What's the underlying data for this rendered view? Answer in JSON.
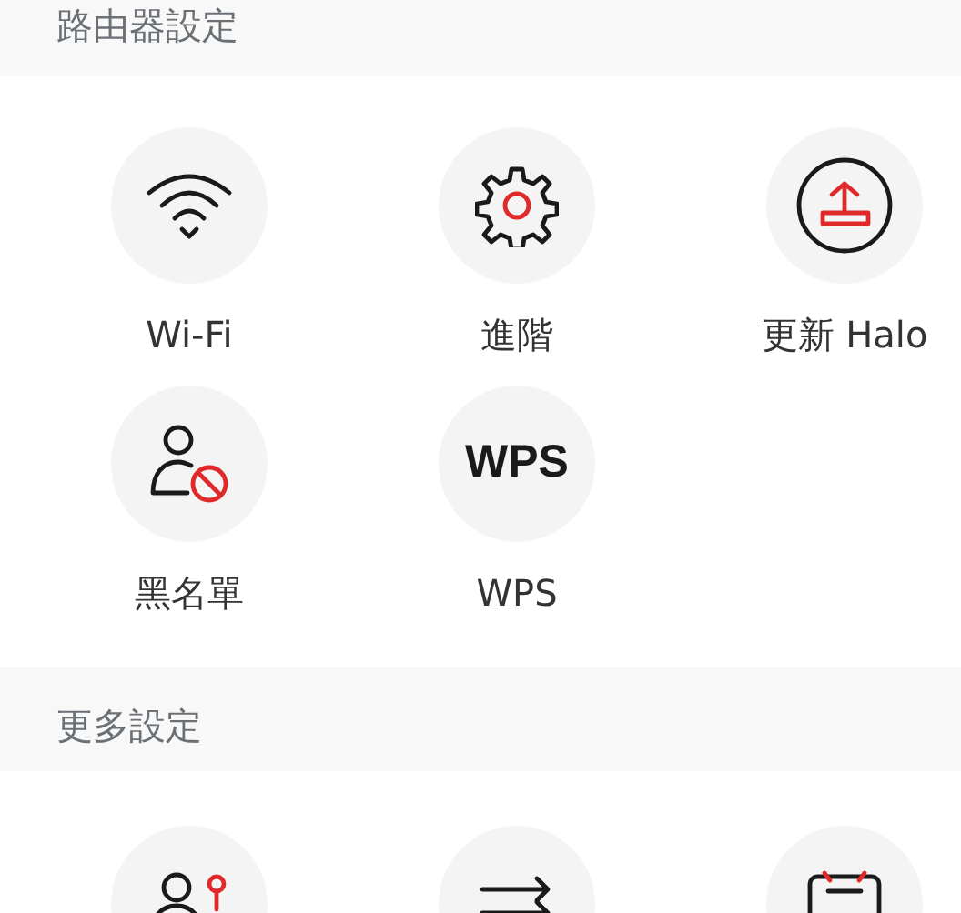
{
  "sections": [
    {
      "title": "路由器設定",
      "items": [
        {
          "kind": "icon",
          "label": "Wi-Fi"
        },
        {
          "kind": "icon",
          "label": "進階"
        },
        {
          "kind": "icon",
          "label": "更新 Halo"
        },
        {
          "kind": "icon",
          "label": "黑名單"
        },
        {
          "kind": "glyph",
          "glyph": "WPS",
          "label": "WPS"
        }
      ]
    },
    {
      "title": "更多設定",
      "items": [
        {
          "kind": "icon"
        },
        {
          "kind": "icon"
        },
        {
          "kind": "icon"
        }
      ]
    }
  ]
}
